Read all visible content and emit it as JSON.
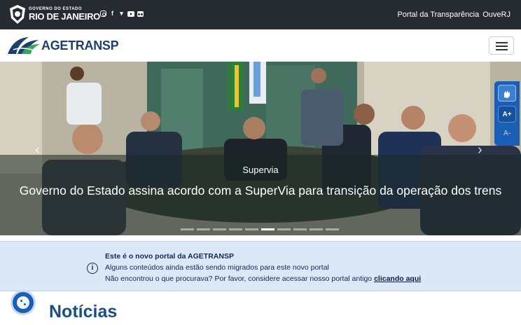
{
  "gov_bar": {
    "logo_small": "GOVERNO DO ESTADO",
    "logo_big": "RIO DE JANEIRO",
    "social_icons": [
      "instagram-icon",
      "facebook-icon",
      "twitter-icon",
      "youtube-icon",
      "flickr-icon"
    ],
    "links": [
      "Portal da Transparência",
      "OuveRJ"
    ]
  },
  "header": {
    "brand": "AGETRANSP",
    "menu_icon": "hamburger-menu-icon"
  },
  "carousel": {
    "category": "Supervia",
    "title": "Governo do Estado assina acordo com a SuperVia para transição da operação dos trens",
    "slide_count": 10,
    "active_slide": 6
  },
  "accessibility": {
    "vlibras_icon": "sign-language-hands-icon",
    "increase": "A+",
    "decrease": "A-"
  },
  "notice": {
    "title": "Este é o novo portal da AGETRANSP",
    "line1": "Alguns conteúdos ainda estão sendo migrados para este novo portal",
    "line2": "Não encontrou o que procurava? Por favor, considere acessar nosso portal antigo",
    "link": "clicando aqui",
    "icon": "info-circle-icon"
  },
  "section": {
    "heading": "Notícias"
  },
  "colors": {
    "gov_bar_bg": "#262b31",
    "brand_blue": "#1c3f6e",
    "notice_bg": "#dbe8f8",
    "heading_blue": "#1a4e86",
    "accessibility_blue": "#1a5fb4"
  }
}
